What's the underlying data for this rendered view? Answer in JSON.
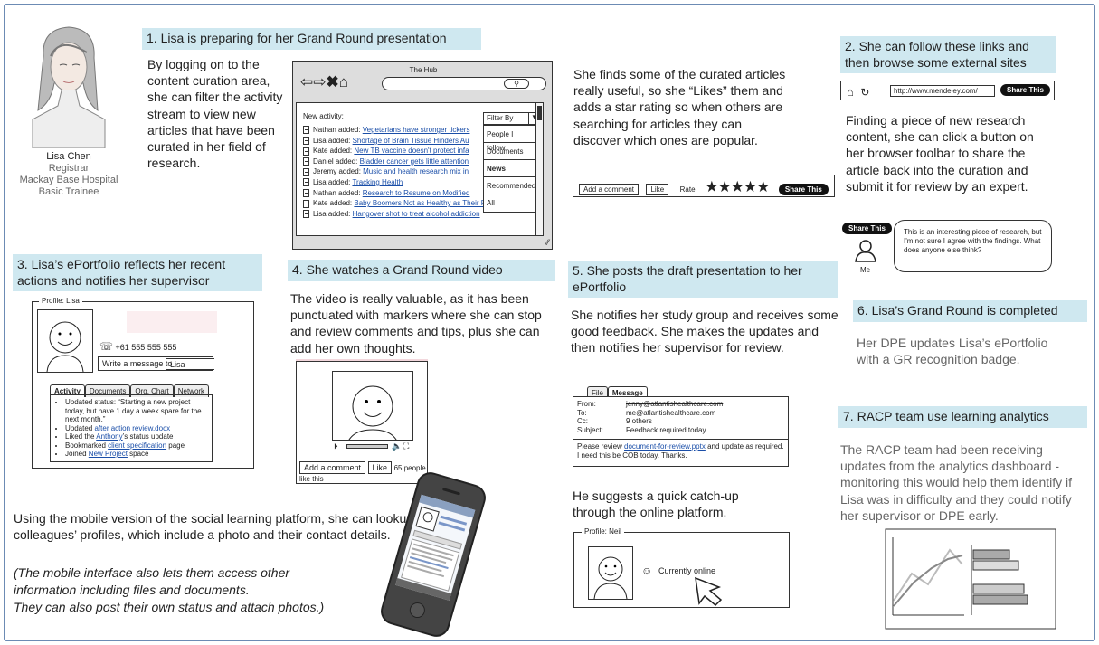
{
  "person": {
    "name": "Lisa Chen",
    "role": "Registrar",
    "hospital": "Mackay Base Hospital",
    "level": "Basic Trainee"
  },
  "step1": {
    "heading": "1. Lisa is preparing for her Grand Round presentation",
    "text": "By logging on to the content curation area, she can filter the activity stream to view new articles that have been curated in her field of research."
  },
  "hub": {
    "title": "The Hub",
    "new_activity": "New activity:",
    "filter_label": "Filter By",
    "filter_options": [
      "People I follow",
      "Documents",
      "News",
      "Recommended",
      "All"
    ],
    "feed": [
      {
        "who": "Nathan added: ",
        "link": "Vegetarians have stronger tickers"
      },
      {
        "who": "Lisa added: ",
        "link": "Shortage of Brain Tissue Hinders Au"
      },
      {
        "who": "Kate added: ",
        "link": "New TB vaccine doesn't protect infa"
      },
      {
        "who": "Daniel added: ",
        "link": "Bladder cancer gets little attention"
      },
      {
        "who": "Jeremy added: ",
        "link": "Music and health research mix in"
      },
      {
        "who": "Lisa added: ",
        "link": "Tracking Health"
      },
      {
        "who": "Nathan added: ",
        "link": "Research to Resume on Modified"
      },
      {
        "who": "Kate added: ",
        "link": "Baby Boomers Not as Healthy as Their Parents"
      },
      {
        "who": "Lisa added: ",
        "link": "Hangover shot to treat alcohol addiction"
      }
    ]
  },
  "likes": {
    "text": "She finds some of the curated articles really useful, so she “Likes” them and adds a star rating so when others are searching for articles they can discover which ones are popular.",
    "add_comment": "Add a comment",
    "like": "Like",
    "rate": "Rate:",
    "share": "Share This",
    "stars": "★★★★★"
  },
  "step2": {
    "heading": "2. She can follow these links and then browse some external sites",
    "url": "http://www.mendeley.com/",
    "share": "Share This",
    "text": "Finding a piece of new research content, she can click a button on her browser toolbar to share the article back into the curation and submit it for review by an expert.",
    "bubble": "This is an interesting piece of research, but I'm not sure I agree with the findings. What does anyone else think?",
    "me": "Me"
  },
  "step3": {
    "heading": "3. Lisa’s ePortfolio reflects her recent actions and notifies her supervisor",
    "profile_label": "Profile: Lisa",
    "phone": "+61 555 555 555",
    "write": "Write a message to",
    "to": "Lisa",
    "tabs": [
      "Activity",
      "Documents",
      "Org. Chart",
      "Network"
    ],
    "items": [
      {
        "pre": "Updated status: “Starting a new project today, but have 1 day a week spare for the next month.”",
        "link": "",
        "post": ""
      },
      {
        "pre": "Updated ",
        "link": "after action review.docx",
        "post": ""
      },
      {
        "pre": "Liked the ",
        "link": "Anthony",
        "post": "’s status update"
      },
      {
        "pre": "Bookmarked ",
        "link": "client specification",
        "post": " page"
      },
      {
        "pre": "Joined ",
        "link": "New Project",
        "post": " space"
      }
    ]
  },
  "step4": {
    "heading": "4. She watches a Grand Round video",
    "text": "The video is really valuable, as it has been punctuated with markers where she can stop and review comments and tips, plus she can add her own thoughts.",
    "add_comment": "Add a comment",
    "like": "Like",
    "likes_count": "65 people like this"
  },
  "mobile": {
    "text": "Using the mobile version of the social learning platform, she can lookup colleagues’ profiles, which include a photo and their contact details.",
    "note1": "(The mobile interface also lets them access other",
    "note2": "information including files and documents.",
    "note3": "They can also post their own status and attach photos.)"
  },
  "step5": {
    "heading": "5. She posts the draft presentation to her ePortfolio",
    "text": "She notifies her study group and receives some good feedback. She makes the updates and then notifies her supervisor for review.",
    "tabs": [
      "File",
      "Message"
    ],
    "from_label": "From:",
    "from_val": "jenny@atlantishealthcare.com",
    "to_label": "To:",
    "to_val": "me@atlantishealthcare.com",
    "cc_label": "Cc:",
    "cc_val": "9 others",
    "subject_label": "Subject:",
    "subject_val": "Feedback required today",
    "msg_pre": "Please review ",
    "msg_link": "document-for-review.pptx",
    "msg_post": " and update as required. I need this be COB today. Thanks.",
    "catchup": "He suggests a quick catch-up through the online platform.",
    "profile_label": "Profile: Neil",
    "online": "Currently online"
  },
  "step6": {
    "heading": "6. Lisa’s Grand Round is completed",
    "text": "Her DPE updates Lisa’s ePortfolio with a GR recognition badge."
  },
  "step7": {
    "heading": "7. RACP team use learning analytics",
    "text": "The RACP team had been receiving updates from the analytics dashboard - monitoring this would help them identify if Lisa was in difficulty and they could notify her supervisor or DPE early."
  },
  "colors": {
    "highlight": "#cfe8f0",
    "link": "#1a4ea8",
    "frame": "#6c8bb4"
  }
}
